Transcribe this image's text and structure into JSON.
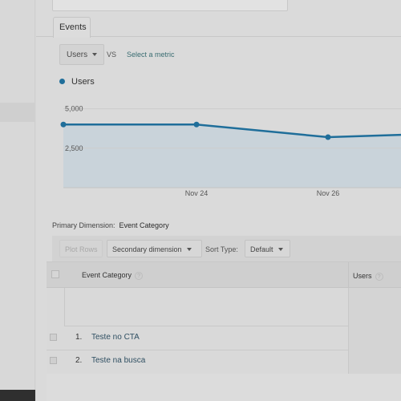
{
  "tabs": [
    {
      "label": "Events"
    }
  ],
  "metric": {
    "primary": "Users",
    "vs": "VS",
    "select_link": "Select a metric"
  },
  "legend": {
    "label": "Users",
    "color": "#1f6e9a"
  },
  "chart_data": {
    "type": "area",
    "x": [
      "",
      "Nov 24",
      "Nov 26",
      ""
    ],
    "series": [
      {
        "name": "Users",
        "values": [
          4000,
          4000,
          3200,
          3350
        ]
      }
    ],
    "yticks": [
      "5,000",
      "2,500"
    ],
    "ylim": [
      0,
      6300
    ],
    "line_color": "#1f6e9a",
    "fill_color": "#c9d3da"
  },
  "primary_dimension": {
    "label": "Primary Dimension:",
    "value": "Event Category"
  },
  "toolbar": {
    "plot_rows": "Plot Rows",
    "secondary_dimension": "Secondary dimension",
    "sort_type_label": "Sort Type:",
    "sort_type_value": "Default"
  },
  "table": {
    "columns": {
      "category": "Event Category",
      "users": "Users"
    },
    "rows": [
      {
        "index": "1.",
        "name": "Teste no CTA"
      },
      {
        "index": "2.",
        "name": "Teste na busca"
      }
    ]
  }
}
